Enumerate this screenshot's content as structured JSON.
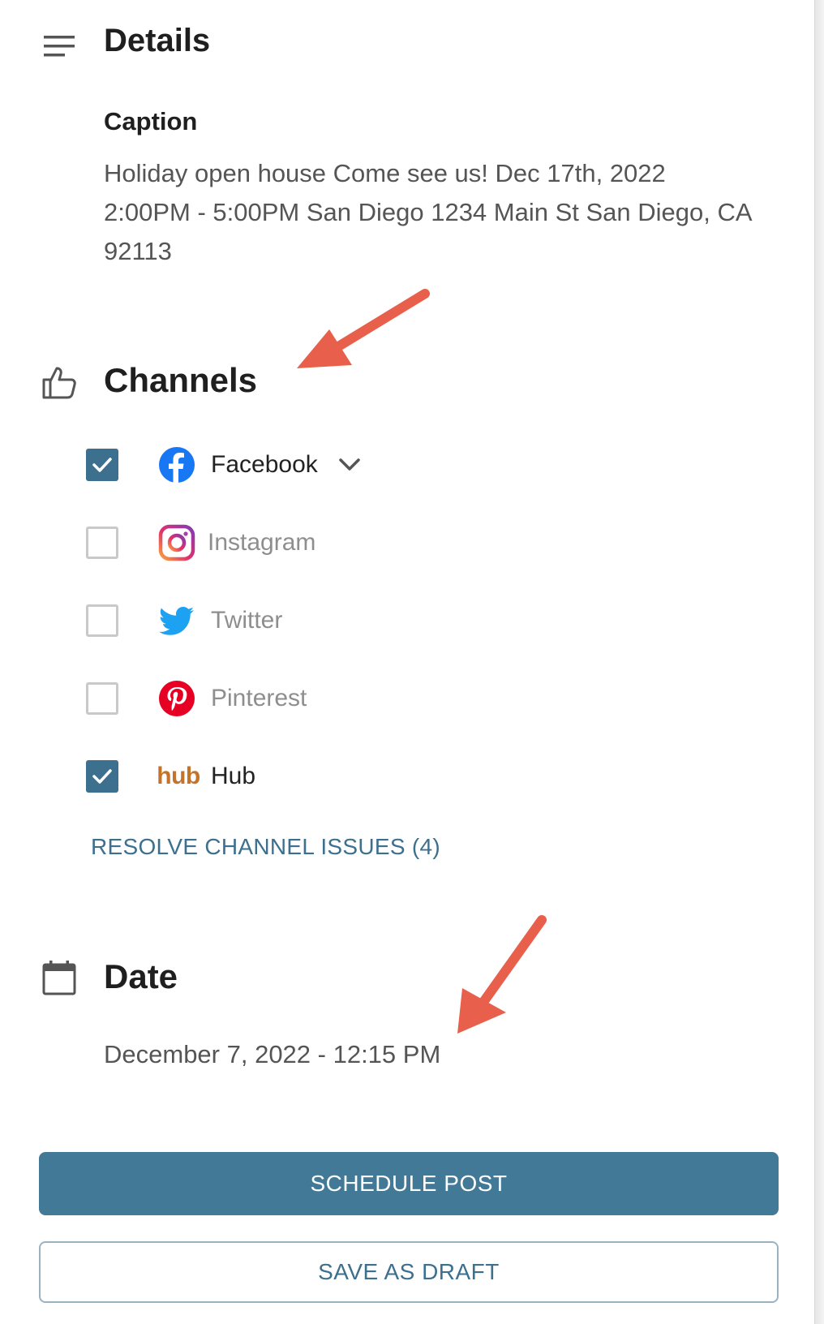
{
  "details": {
    "title": "Details",
    "icon": "menu-icon"
  },
  "caption": {
    "label": "Caption",
    "text": "Holiday open house Come see us! Dec 17th, 2022 2:00PM - 5:00PM San Diego 1234 Main St San Diego, CA 92113"
  },
  "channels": {
    "title": "Channels",
    "icon": "thumbs-up-icon",
    "items": [
      {
        "label": "Facebook",
        "checked": true,
        "icon": "facebook-icon",
        "expandable": true
      },
      {
        "label": "Instagram",
        "checked": false,
        "icon": "instagram-icon"
      },
      {
        "label": "Twitter",
        "checked": false,
        "icon": "twitter-icon"
      },
      {
        "label": "Pinterest",
        "checked": false,
        "icon": "pinterest-icon"
      },
      {
        "label": "Hub",
        "checked": true,
        "icon": "hub-logo",
        "logo_text": "hub"
      }
    ],
    "resolve_link": "RESOLVE CHANNEL ISSUES (4)"
  },
  "date": {
    "title": "Date",
    "icon": "calendar-icon",
    "value": "December 7, 2022 - 12:15 PM"
  },
  "actions": {
    "schedule_label": "SCHEDULE POST",
    "draft_label": "SAVE AS DRAFT"
  },
  "colors": {
    "primary": "#427997",
    "link": "#3d6f8e",
    "checkbox_checked": "#3d6f8e",
    "annotation_arrow": "#e8604c",
    "hub_orange": "#c4732a"
  }
}
